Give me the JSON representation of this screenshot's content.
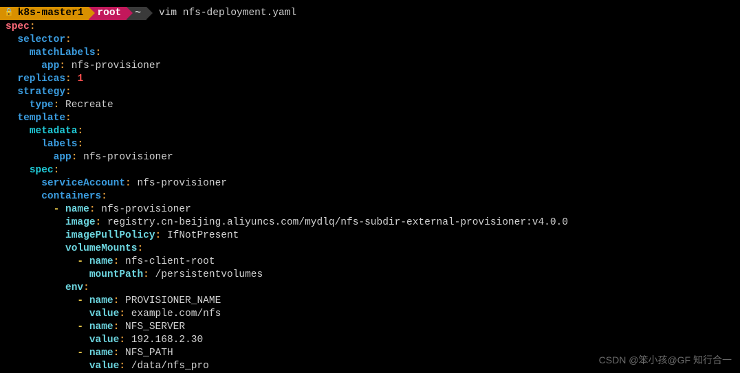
{
  "prompt": {
    "host": "k8s-master1",
    "user": "root",
    "path": "~",
    "command": "vim nfs-deployment.yaml"
  },
  "yaml": {
    "spec": "spec",
    "selector": "selector",
    "matchLabels": "matchLabels",
    "app1_key": "app",
    "app1_val": "nfs-provisioner",
    "replicas_key": "replicas",
    "replicas_val": "1",
    "strategy": "strategy",
    "type_key": "type",
    "type_val": "Recreate",
    "template": "template",
    "metadata": "metadata",
    "labels": "labels",
    "app2_key": "app",
    "app2_val": "nfs-provisioner",
    "spec2": "spec",
    "serviceAccount_key": "serviceAccount",
    "serviceAccount_val": "nfs-provisioner",
    "containers": "containers",
    "c_name_key": "name",
    "c_name_val": "nfs-provisioner",
    "c_image_key": "image",
    "c_image_val": "registry.cn-beijing.aliyuncs.com/mydlq/nfs-subdir-external-provisioner:v4.0.0",
    "c_ipp_key": "imagePullPolicy",
    "c_ipp_val": "IfNotPresent",
    "volumeMounts": "volumeMounts",
    "vm_name_key": "name",
    "vm_name_val": "nfs-client-root",
    "vm_mountPath_key": "mountPath",
    "vm_mountPath_val": "/persistentvolumes",
    "env": "env",
    "env1_name_key": "name",
    "env1_name_val": "PROVISIONER_NAME",
    "env1_value_key": "value",
    "env1_value_val": "example.com/nfs",
    "env2_name_key": "name",
    "env2_name_val": "NFS_SERVER",
    "env2_value_key": "value",
    "env2_value_val": "192.168.2.30",
    "env3_name_key": "name",
    "env3_name_val": "NFS_PATH",
    "env3_value_key": "value",
    "env3_value_val": "/data/nfs_pro"
  },
  "watermark": "CSDN @笨小孩@GF 知行合一"
}
